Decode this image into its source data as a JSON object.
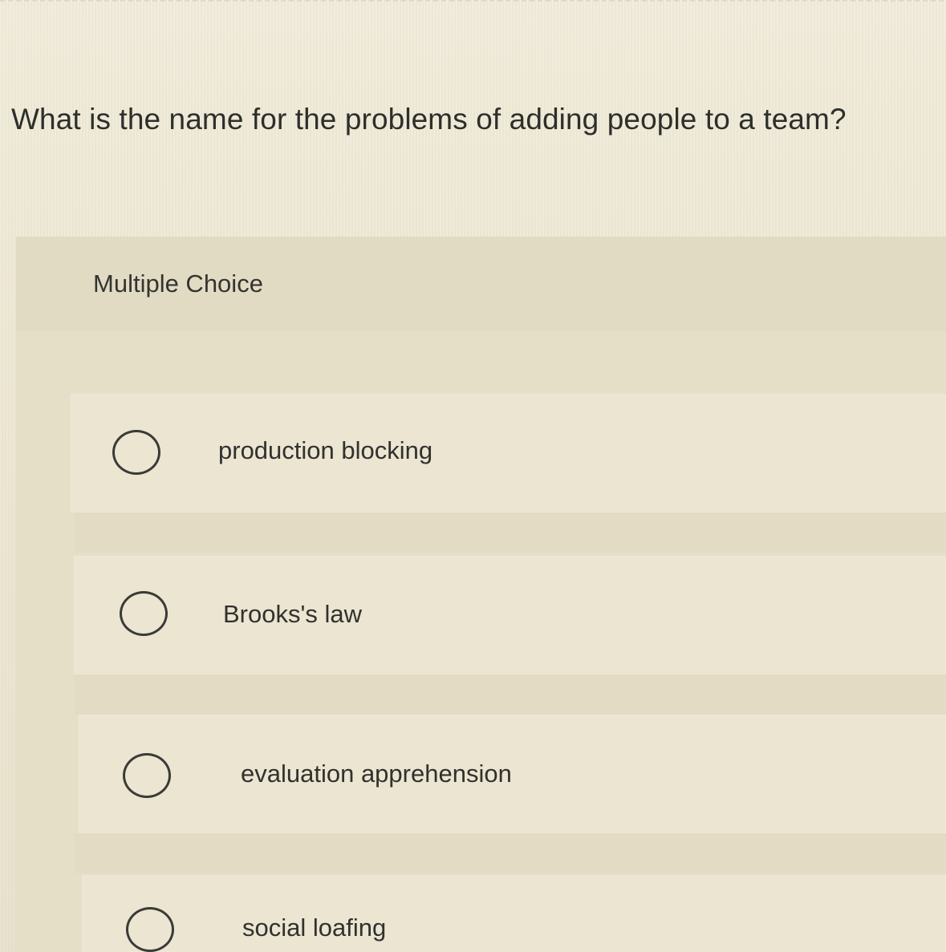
{
  "question": {
    "text": "What is the name for the problems of adding people to a team?"
  },
  "multiple_choice": {
    "label": "Multiple Choice",
    "options": [
      {
        "label": "production blocking",
        "selected": false
      },
      {
        "label": "Brooks's law",
        "selected": false
      },
      {
        "label": "evaluation apprehension",
        "selected": false
      },
      {
        "label": "social loafing",
        "selected": false
      }
    ]
  },
  "colors": {
    "background": "#efe9d6",
    "panel": "#e6dfc8",
    "option_background": "#ebe5d1",
    "text": "#2f2f2c",
    "radio_border": "#3a3a37"
  },
  "icons": {
    "radio": "empty-radio-circle"
  }
}
